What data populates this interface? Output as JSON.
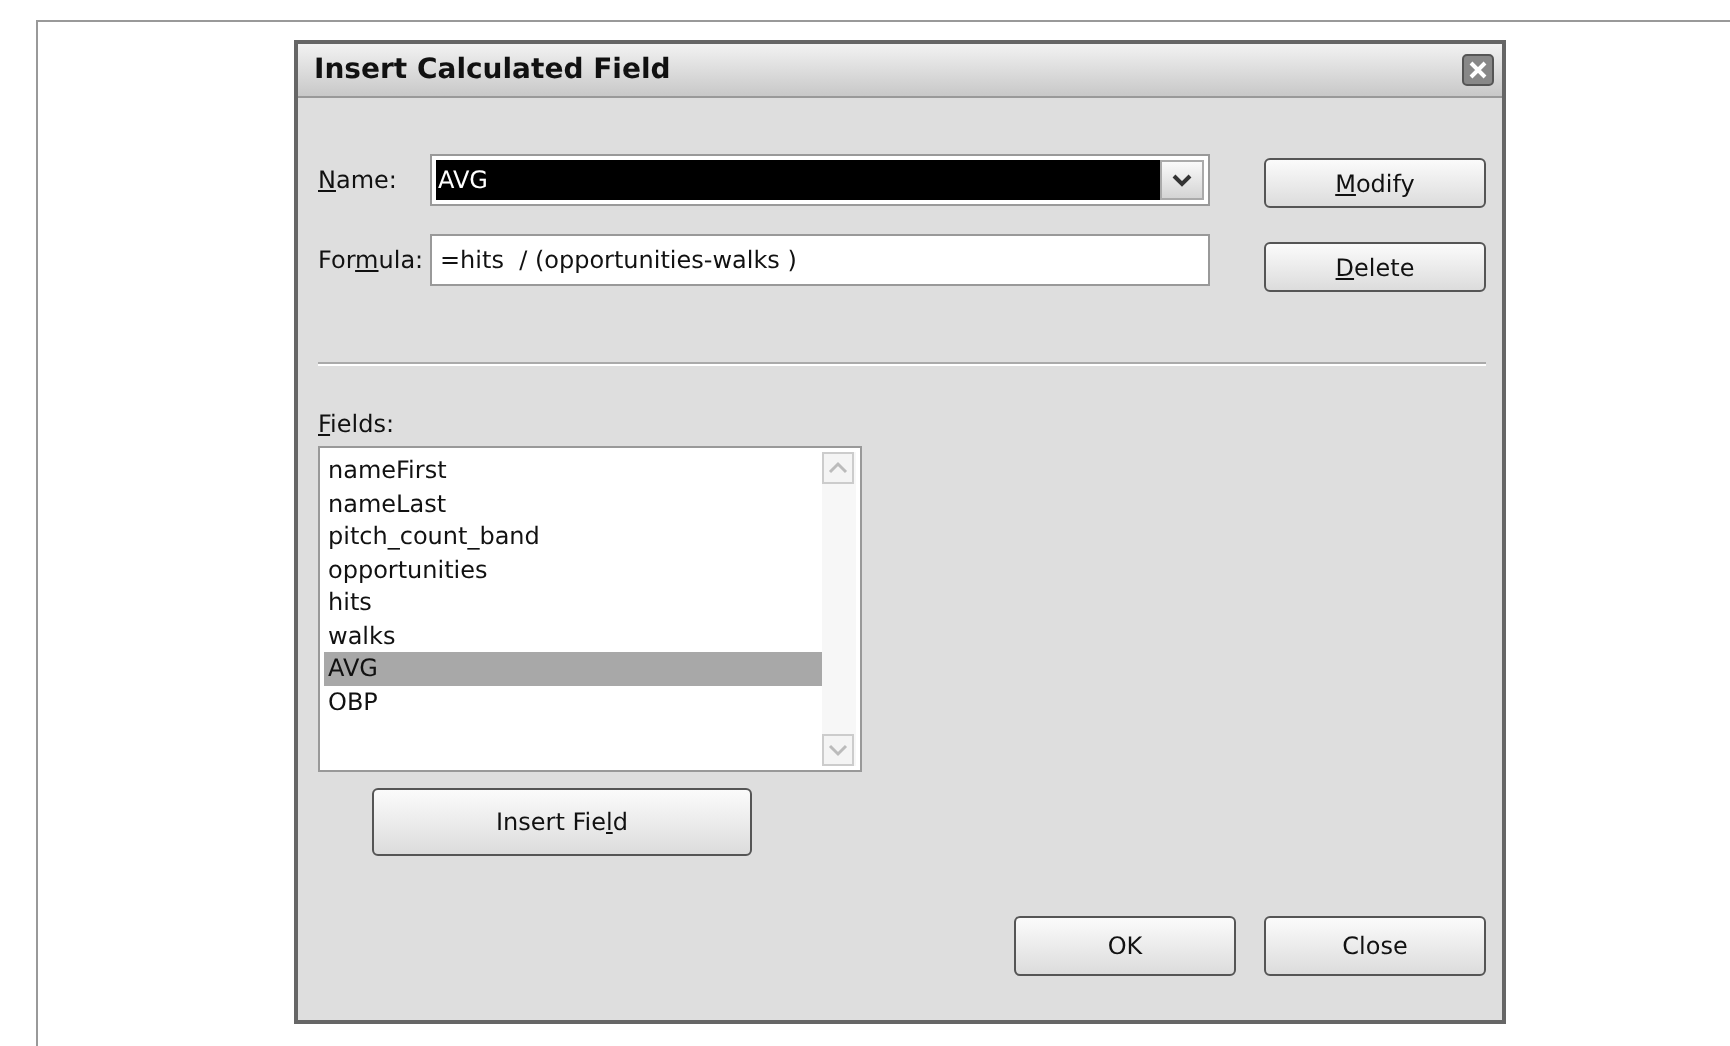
{
  "window": {
    "title": "Insert Calculated Field"
  },
  "name_field": {
    "label": {
      "key": "N",
      "after": "ame:"
    },
    "value": "AVG"
  },
  "formula_field": {
    "label": {
      "before": "For",
      "key": "m",
      "after": "ula:"
    },
    "value": "=hits  / (opportunities-walks )"
  },
  "side_buttons": [
    {
      "key": "M",
      "after": "odify"
    },
    {
      "key": "D",
      "after": "elete"
    }
  ],
  "fields_label": {
    "key": "F",
    "after": "ields:"
  },
  "fields": [
    {
      "label": "nameFirst",
      "selected": false
    },
    {
      "label": "nameLast",
      "selected": false
    },
    {
      "label": "pitch_count_band",
      "selected": false
    },
    {
      "label": "opportunities",
      "selected": false
    },
    {
      "label": "hits",
      "selected": false
    },
    {
      "label": "walks",
      "selected": false
    },
    {
      "label": "AVG",
      "selected": true
    },
    {
      "label": "OBP",
      "selected": false
    }
  ],
  "insert_button": {
    "before": "Insert Fie",
    "key": "l",
    "after": "d"
  },
  "buttons": [
    "OK",
    "Close"
  ]
}
